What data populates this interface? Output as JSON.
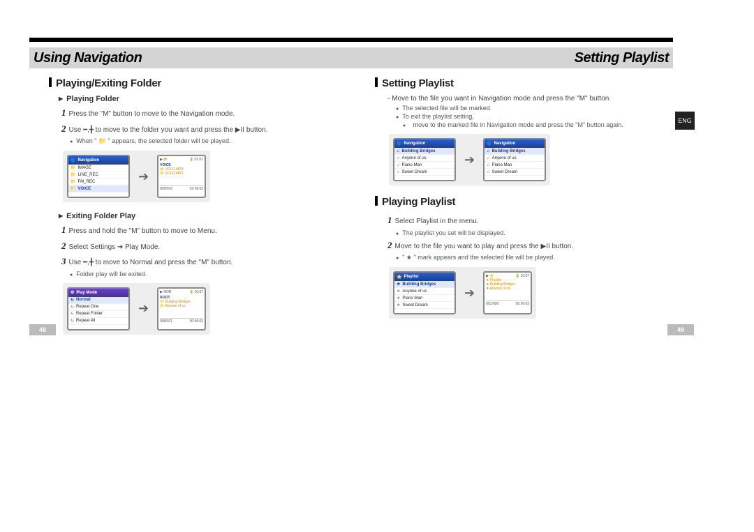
{
  "header": {
    "left": "Using Navigation",
    "right": "Setting Playlist"
  },
  "eng_tab": "ENG",
  "left_col": {
    "section": "Playing/Exiting Folder",
    "sub1": "Playing Folder",
    "s1": "Press the \"M\" button to move to the Navigation mode.",
    "s2_a": "Use ",
    "s2_b": " to move to the folder you want and press the ",
    "s2_c": " button.",
    "b1": "When \" 📁 \" appears, the selected folder will be played.",
    "sub2": "Exiting Folder Play",
    "s3": "Press and hold the \"M\" button to move to Menu.",
    "s4": "Select Settings ➔ Play Mode.",
    "s5_a": "Use ",
    "s5_b": " to move to Normal and press the \"M\" button.",
    "b2": "Folder play will be exited.",
    "device1": {
      "left_head": "Navigation",
      "left_rows": [
        "IMAGE",
        "LINE_REC",
        "FM_REC",
        "VOICE"
      ],
      "right_rows": [
        "VOICE",
        "VOO1.MP3",
        "VOO2.MP3"
      ],
      "right_footer_l": "005/010",
      "right_time": "01:07",
      "right_dur": "02:56:03"
    },
    "device2": {
      "left_head": "Play Mode",
      "left_rows": [
        "Normal",
        "Repeat One",
        "Repeat Folder",
        "Repeat All"
      ],
      "right_rows": [
        "ROOT",
        "Building Bridges",
        "Anyone of us"
      ],
      "right_footer_l": "006/011",
      "right_time": "10:07",
      "right_dur": "00:56:03",
      "right_tag": "NOR"
    }
  },
  "right_col": {
    "section1": "Setting Playlist",
    "dash": "- Move to the file you want in Navigation mode and press the \"M\" button.",
    "b1": "The selected file will be marked.",
    "b2": "To exit the playlist setting,",
    "b2b": "move to the marked file in Navigation mode and press the \"M\" button again.",
    "device1": {
      "head": "Navigation",
      "rows": [
        "Building Bridges",
        "Anyone of us",
        "Piano Man",
        "Sweet Dream"
      ]
    },
    "section2": "Playing Playlist",
    "s1": "Select Playlist in the menu.",
    "b3": "The playlist you set will be displayed.",
    "s2_a": "Move to the file you want to play and press the ",
    "s2_b": " button.",
    "b4": "\" ★ \" mark appears and the selected file will be played.",
    "device2": {
      "head": "Playlist",
      "rows": [
        "Building Bridges",
        "Anyone of us",
        "Piano Man",
        "Sweet Dream"
      ],
      "right_rows": [
        "Playlist",
        "Building Bridges",
        "Anyone of us"
      ],
      "right_footer_l": "001/006",
      "right_time": "10:07",
      "right_dur": "00:56:03"
    }
  },
  "page_left": "48",
  "page_right": "49"
}
